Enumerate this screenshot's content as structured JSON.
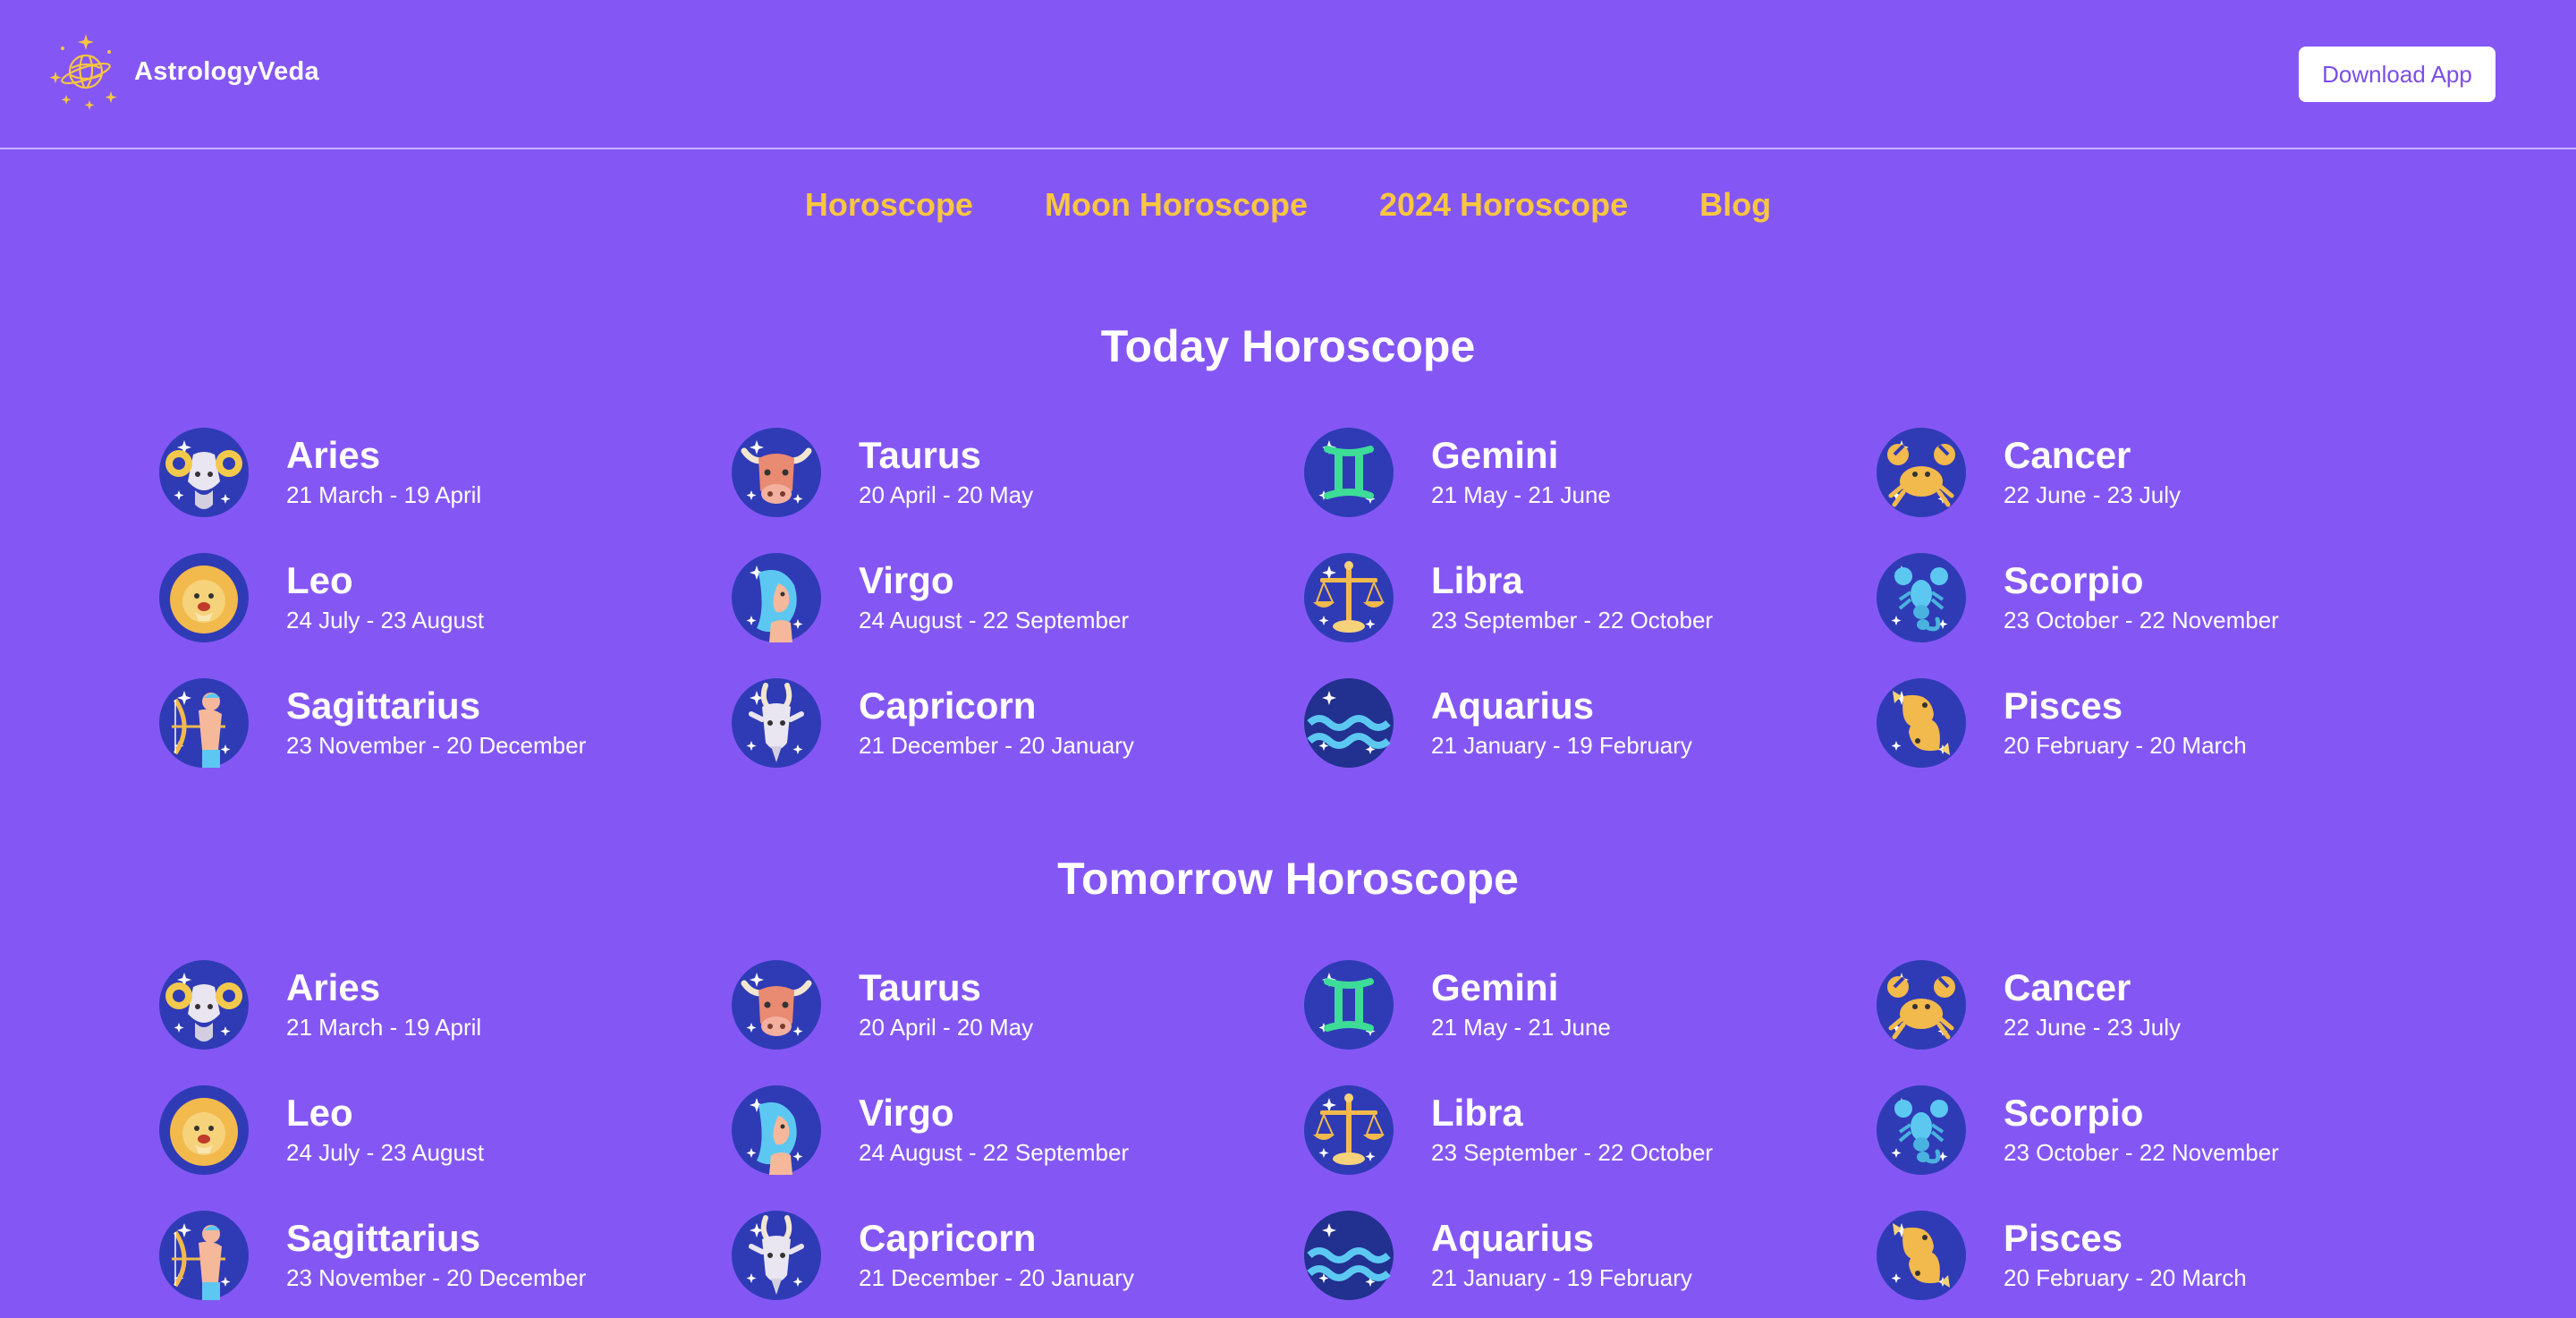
{
  "brand": {
    "name": "AstrologyVeda",
    "accent": "#f8c640",
    "background": "#8457f5"
  },
  "header": {
    "download_label": "Download App"
  },
  "nav": {
    "items": [
      {
        "label": "Horoscope"
      },
      {
        "label": "Moon Horoscope"
      },
      {
        "label": "2024 Horoscope"
      },
      {
        "label": "Blog"
      }
    ]
  },
  "sections": [
    {
      "title": "Today Horoscope",
      "signs": [
        {
          "name": "Aries",
          "dates": "21 March - 19 April",
          "icon": "aries-icon"
        },
        {
          "name": "Taurus",
          "dates": "20 April - 20 May",
          "icon": "taurus-icon"
        },
        {
          "name": "Gemini",
          "dates": "21 May - 21 June",
          "icon": "gemini-icon"
        },
        {
          "name": "Cancer",
          "dates": "22 June - 23 July",
          "icon": "cancer-icon"
        },
        {
          "name": "Leo",
          "dates": "24 July - 23 August",
          "icon": "leo-icon"
        },
        {
          "name": "Virgo",
          "dates": "24 August - 22 September",
          "icon": "virgo-icon"
        },
        {
          "name": "Libra",
          "dates": "23 September - 22 October",
          "icon": "libra-icon"
        },
        {
          "name": "Scorpio",
          "dates": "23 October - 22 November",
          "icon": "scorpio-icon"
        },
        {
          "name": "Sagittarius",
          "dates": "23 November - 20 December",
          "icon": "sagittarius-icon"
        },
        {
          "name": "Capricorn",
          "dates": "21 December - 20 January",
          "icon": "capricorn-icon"
        },
        {
          "name": "Aquarius",
          "dates": "21 January - 19 February",
          "icon": "aquarius-icon"
        },
        {
          "name": "Pisces",
          "dates": "20 February - 20 March",
          "icon": "pisces-icon"
        }
      ]
    },
    {
      "title": "Tomorrow Horoscope",
      "signs": [
        {
          "name": "Aries",
          "dates": "21 March - 19 April",
          "icon": "aries-icon"
        },
        {
          "name": "Taurus",
          "dates": "20 April - 20 May",
          "icon": "taurus-icon"
        },
        {
          "name": "Gemini",
          "dates": "21 May - 21 June",
          "icon": "gemini-icon"
        },
        {
          "name": "Cancer",
          "dates": "22 June - 23 July",
          "icon": "cancer-icon"
        },
        {
          "name": "Leo",
          "dates": "24 July - 23 August",
          "icon": "leo-icon"
        },
        {
          "name": "Virgo",
          "dates": "24 August - 22 September",
          "icon": "virgo-icon"
        },
        {
          "name": "Libra",
          "dates": "23 September - 22 October",
          "icon": "libra-icon"
        },
        {
          "name": "Scorpio",
          "dates": "23 October - 22 November",
          "icon": "scorpio-icon"
        },
        {
          "name": "Sagittarius",
          "dates": "23 November - 20 December",
          "icon": "sagittarius-icon"
        },
        {
          "name": "Capricorn",
          "dates": "21 December - 20 January",
          "icon": "capricorn-icon"
        },
        {
          "name": "Aquarius",
          "dates": "21 January - 19 February",
          "icon": "aquarius-icon"
        },
        {
          "name": "Pisces",
          "dates": "20 February - 20 March",
          "icon": "pisces-icon"
        }
      ]
    }
  ]
}
